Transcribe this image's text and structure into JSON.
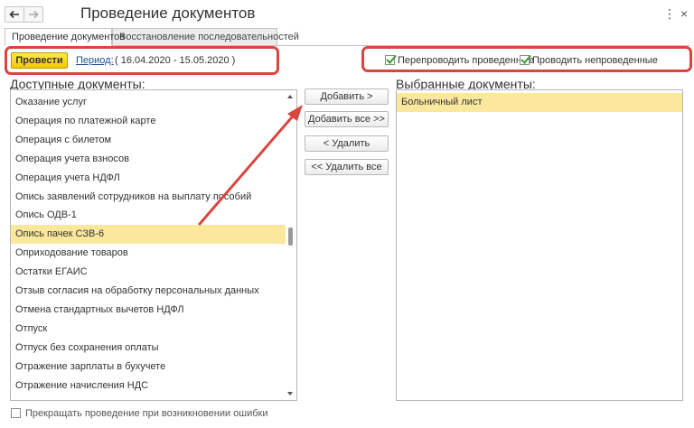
{
  "window": {
    "title": "Проведение документов",
    "nav_back_icon": "arrow-left-icon",
    "nav_forward_icon": "arrow-right-icon"
  },
  "tabs": [
    {
      "label": "Проведение документов",
      "active": true
    },
    {
      "label": "Восстановление последовательностей",
      "active": false
    }
  ],
  "toolbar": {
    "post_button": "Провести",
    "period_link": "Период:",
    "period_value": "( 16.04.2020 - 15.05.2020 )",
    "repost_posted": {
      "label": "Перепроводить проведенные",
      "checked": true
    },
    "post_unposted": {
      "label": "Проводить непроведенные",
      "checked": true
    }
  },
  "available": {
    "title": "Доступные документы:",
    "items": [
      "Оказание услуг",
      "Операция по платежной карте",
      "Операция с билетом",
      "Операция учета взносов",
      "Операция учета НДФЛ",
      "Опись заявлений сотрудников на выплату пособий",
      "Опись ОДВ-1",
      "Опись пачек СЗВ-6",
      "Оприходование товаров",
      "Остатки ЕГАИС",
      "Отзыв согласия на обработку персональных данных",
      "Отмена стандартных вычетов НДФЛ",
      "Отпуск",
      "Отпуск без сохранения оплаты",
      "Отражение зарплаты в бухучете",
      "Отражение начисления НДС"
    ],
    "selected_index": 7
  },
  "actions": {
    "add": "Добавить >",
    "add_all": "Добавить все >>",
    "remove": "< Удалить",
    "remove_all": "<< Удалить все"
  },
  "selected": {
    "title": "Выбранные документы:",
    "items": [
      "Больничный лист"
    ]
  },
  "footer": {
    "stop_on_error": {
      "label": "Прекращать проведение при возникновении ошибки",
      "checked": false
    }
  },
  "colors": {
    "accent_button": "#f5c800",
    "selection": "#fbe89d",
    "annotation_red": "#d9453f",
    "link": "#1a4f9c",
    "checkmark": "#3a9a3a"
  }
}
